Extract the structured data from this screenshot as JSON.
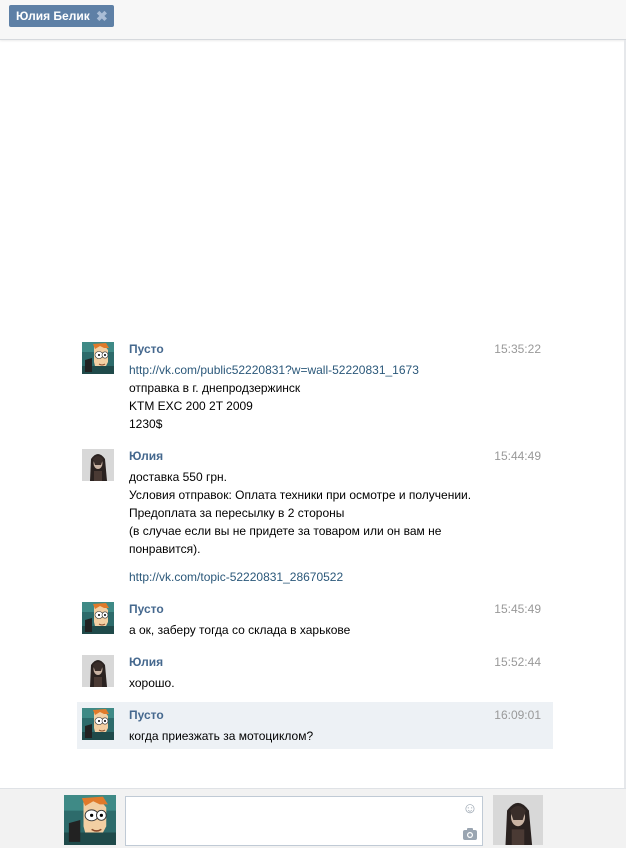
{
  "tab": {
    "label": "Юлия Белик",
    "close_glyph": "✖"
  },
  "messages": [
    {
      "author": "Пусто",
      "avatar": "fry-cartoon-avatar",
      "time": "15:35:22",
      "lines": [
        {
          "type": "link",
          "text": "http://vk.com/public52220831?w=wall-52220831_1673"
        },
        {
          "type": "text",
          "text": "отправка в г. днепродзержинск"
        },
        {
          "type": "text",
          "text": "KTM EXC 200 2T 2009"
        },
        {
          "type": "text",
          "text": "1230$"
        }
      ]
    },
    {
      "author": "Юлия",
      "avatar": "girl-photo-avatar",
      "time": "15:44:49",
      "lines": [
        {
          "type": "text",
          "text": "доставка 550 грн."
        },
        {
          "type": "text",
          "text": "Условия отправок: Оплата техники при осмотре и получении."
        },
        {
          "type": "text",
          "text": "Предоплата за пересылку в 2 стороны"
        },
        {
          "type": "text",
          "text": "(в случае если вы не придете за товаром или он вам не"
        },
        {
          "type": "text",
          "text": "понравится)."
        },
        {
          "type": "link",
          "text": "http://vk.com/topic-52220831_28670522"
        }
      ]
    },
    {
      "author": "Пусто",
      "avatar": "fry-cartoon-avatar",
      "time": "15:45:49",
      "lines": [
        {
          "type": "text",
          "text": "а ок, заберу тогда со склада в харькове"
        }
      ]
    },
    {
      "author": "Юлия",
      "avatar": "girl-photo-avatar",
      "time": "15:52:44",
      "lines": [
        {
          "type": "text",
          "text": "хорошо."
        }
      ]
    },
    {
      "author": "Пусто",
      "avatar": "fry-cartoon-avatar",
      "time": "16:09:01",
      "highlighted": true,
      "lines": [
        {
          "type": "text",
          "text": "когда приезжать за мотоциклом?"
        }
      ]
    }
  ],
  "composer": {
    "value": "",
    "placeholder": "",
    "icons": [
      "smiley-icon",
      "camera-icon"
    ]
  },
  "colors": {
    "accent": "#5e80a6",
    "author": "#45688e",
    "link": "#2b587a",
    "highlight": "#edf1f5"
  }
}
